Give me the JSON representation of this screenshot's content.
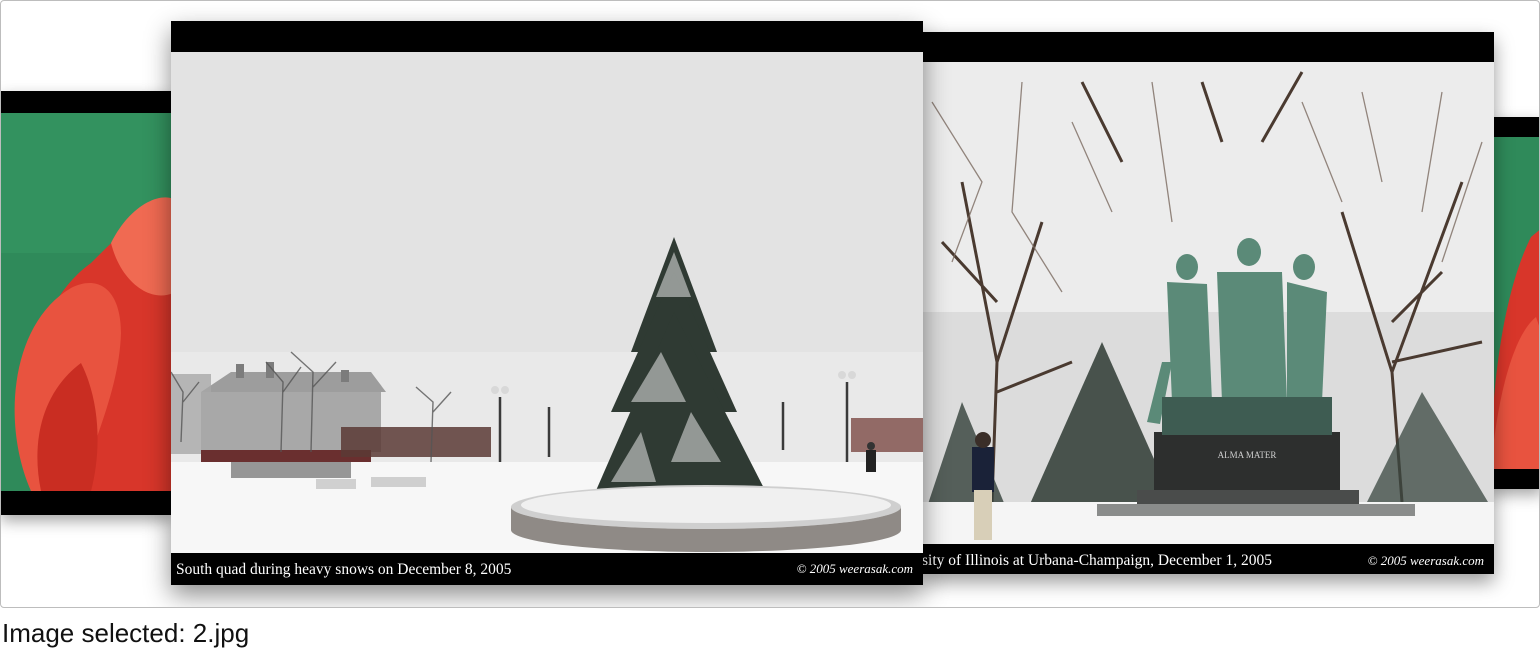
{
  "gallery": {
    "cards": [
      {
        "id": "tulip-left",
        "caption": ""
      },
      {
        "id": "south-quad",
        "caption": "South quad during heavy snows on December 8, 2005",
        "copyright": "© 2005 weerasak.com"
      },
      {
        "id": "alma-mater",
        "caption": "sity of Illinois at Urbana-Champaign, December 1, 2005",
        "copyright": "© 2005 weerasak.com"
      },
      {
        "id": "tulip-right",
        "caption": ""
      }
    ]
  },
  "status": {
    "text": "Image selected: 2.jpg"
  },
  "colors": {
    "tulip_green": "#2e8b57",
    "tulip_red": "#e8453a",
    "snow_sky": "#e8e8e8",
    "statue": "#5b8a78"
  }
}
